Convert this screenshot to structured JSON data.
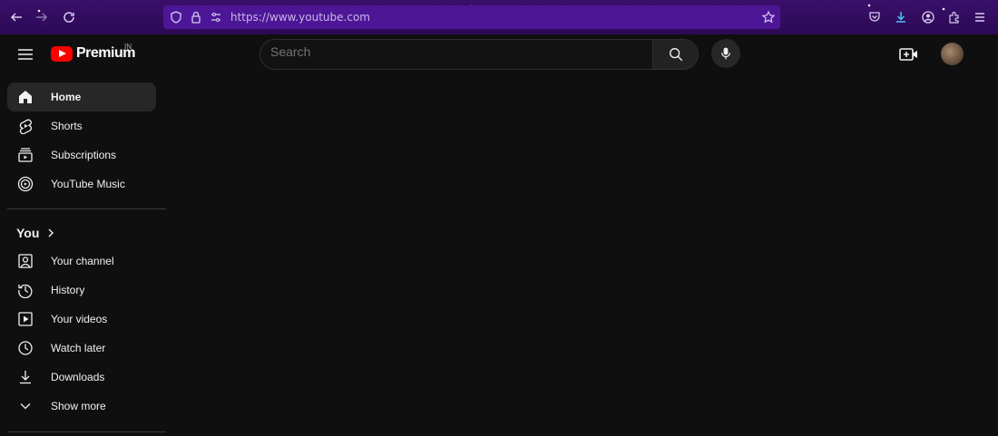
{
  "browser": {
    "url": "https://www.youtube.com",
    "accent_color": "#3a0f6a"
  },
  "header": {
    "logo_text": "Premium",
    "country_code": "IN",
    "search_placeholder": "Search",
    "brand_color": "#ff0000"
  },
  "sidebar": {
    "main_items": [
      {
        "label": "Home",
        "icon": "home-icon",
        "active": true
      },
      {
        "label": "Shorts",
        "icon": "shorts-icon"
      },
      {
        "label": "Subscriptions",
        "icon": "subscriptions-icon"
      },
      {
        "label": "YouTube Music",
        "icon": "youtube-music-icon"
      }
    ],
    "you_header": "You",
    "you_items": [
      {
        "label": "Your channel",
        "icon": "your-channel-icon"
      },
      {
        "label": "History",
        "icon": "history-icon"
      },
      {
        "label": "Your videos",
        "icon": "your-videos-icon"
      },
      {
        "label": "Watch later",
        "icon": "watch-later-icon"
      },
      {
        "label": "Downloads",
        "icon": "downloads-icon"
      },
      {
        "label": "Show more",
        "icon": "chevron-down-icon"
      }
    ]
  }
}
